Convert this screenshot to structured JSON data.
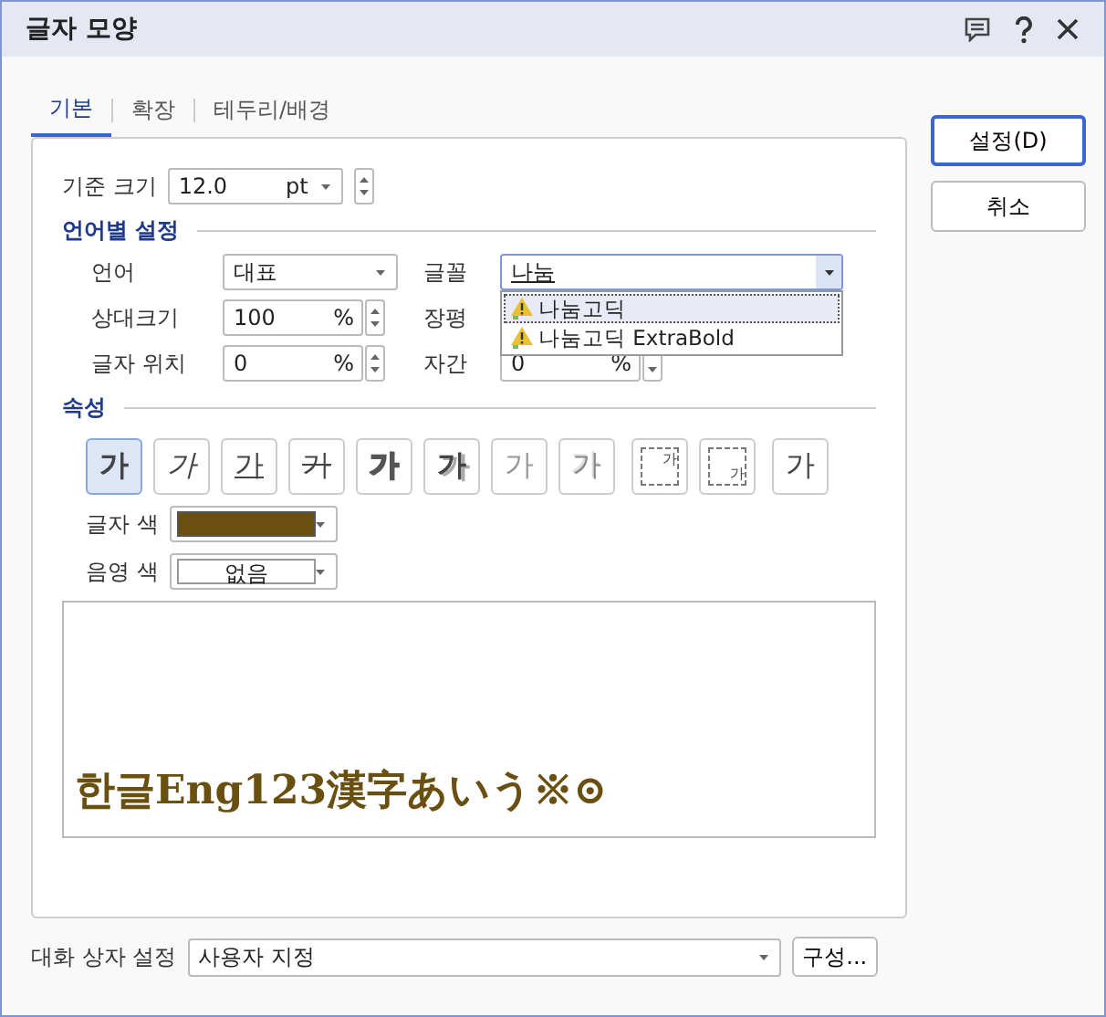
{
  "window": {
    "title": "글자 모양"
  },
  "tabs": [
    {
      "label": "기본",
      "selected": true
    },
    {
      "label": "확장",
      "selected": false
    },
    {
      "label": "테두리/배경",
      "selected": false
    }
  ],
  "base_size": {
    "label": "기준 크기",
    "value": "12.0",
    "unit": "pt"
  },
  "language_section": {
    "title": "언어별 설정",
    "language": {
      "label": "언어",
      "value": "대표"
    },
    "font": {
      "label": "글꼴",
      "value": "나눔",
      "suggestions": [
        {
          "label": "나눔고딕",
          "selected": true
        },
        {
          "label": "나눔고딕 ExtraBold",
          "selected": false
        }
      ]
    },
    "relative_size": {
      "label": "상대크기",
      "value": "100",
      "unit": "%"
    },
    "ratio": {
      "label": "장평"
    },
    "position": {
      "label": "글자 위치",
      "value": "0",
      "unit": "%"
    },
    "spacing": {
      "label": "자간",
      "value": "0",
      "unit": "%"
    }
  },
  "attributes": {
    "title": "속성",
    "buttons": [
      {
        "kind": "bold",
        "text": "가",
        "selected": true
      },
      {
        "kind": "italic",
        "text": "가",
        "selected": false
      },
      {
        "kind": "underline",
        "text": "가",
        "selected": false
      },
      {
        "kind": "strike",
        "text": "가",
        "selected": false
      },
      {
        "kind": "outline",
        "text": "가",
        "selected": false
      },
      {
        "kind": "shadow",
        "text": "가",
        "selected": false
      },
      {
        "kind": "emboss",
        "text": "가",
        "selected": false
      },
      {
        "kind": "engrave",
        "text": "가",
        "selected": false
      },
      {
        "kind": "superscript",
        "text": "가",
        "selected": false
      },
      {
        "kind": "subscript",
        "text": "가",
        "selected": false
      },
      {
        "kind": "normal",
        "text": "가",
        "selected": false
      }
    ],
    "text_color": {
      "label": "글자 색",
      "color": "#6a5010"
    },
    "shade_color": {
      "label": "음영 색",
      "value": "없음"
    }
  },
  "preview": {
    "text": "한글Eng123漢字あいう※⊙"
  },
  "dialog_setting": {
    "label": "대화 상자 설정",
    "value": "사용자 지정",
    "button": "구성..."
  },
  "buttons": [
    {
      "label": "설정(D)",
      "primary": true
    },
    {
      "label": "취소",
      "primary": false
    }
  ]
}
